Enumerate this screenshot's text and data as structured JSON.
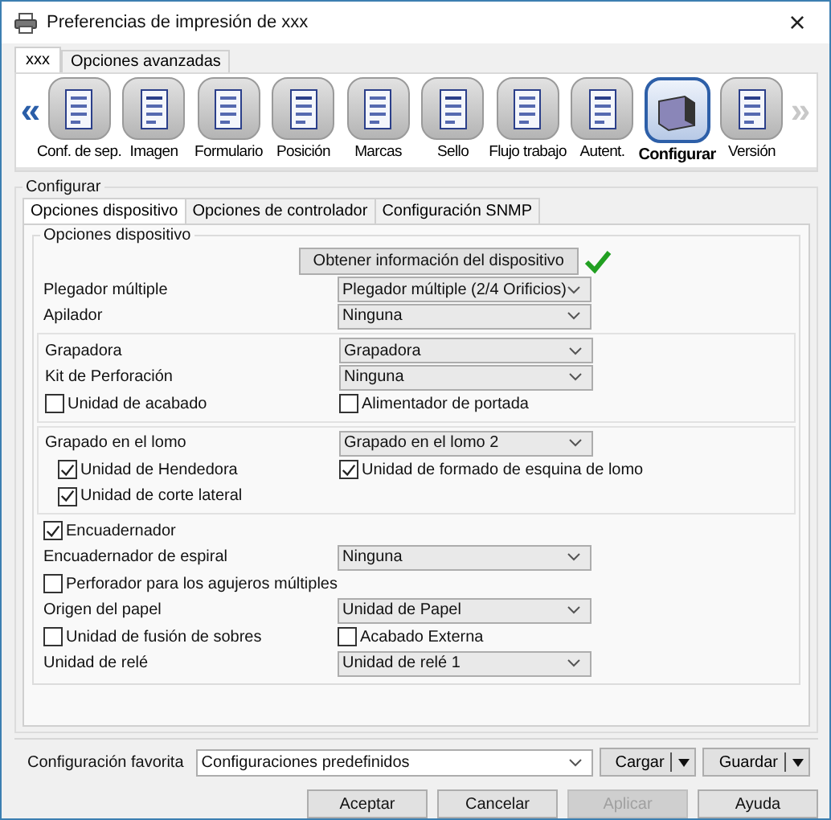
{
  "window": {
    "title": "Preferencias de impresión de xxx",
    "close": "×"
  },
  "tabs": [
    {
      "label": "xxx",
      "selected": true
    },
    {
      "label": "Opciones avanzadas",
      "selected": false
    }
  ],
  "toolbar": {
    "prev": "«",
    "next": "»",
    "next_disabled": true,
    "items": [
      {
        "label": "Conf. de sep.",
        "selected": false
      },
      {
        "label": "Imagen",
        "selected": false
      },
      {
        "label": "Formulario",
        "selected": false
      },
      {
        "label": "Posición",
        "selected": false
      },
      {
        "label": "Marcas",
        "selected": false
      },
      {
        "label": "Sello",
        "selected": false
      },
      {
        "label": "Flujo trabajo",
        "selected": false
      },
      {
        "label": "Autent.",
        "selected": false
      },
      {
        "label": "Configurar",
        "selected": true
      },
      {
        "label": "Versión",
        "selected": false
      }
    ]
  },
  "section": {
    "title": "Configurar",
    "subtabs": [
      {
        "label": "Opciones dispositivo",
        "selected": true
      },
      {
        "label": "Opciones de controlador",
        "selected": false
      },
      {
        "label": "Configuración SNMP",
        "selected": false
      }
    ],
    "group": {
      "title": "Opciones dispositivo",
      "fetch_button": "Obtener información del dispositivo",
      "fetched": true,
      "blocks": [
        {
          "kind": "plain",
          "rows": [
            {
              "kind": "select",
              "label": "Plegador múltiple",
              "value": "Plegador múltiple (2/4 Orificios)"
            },
            {
              "kind": "select",
              "label": "Apilador",
              "value": "Ninguna"
            }
          ]
        },
        {
          "kind": "box",
          "rows": [
            {
              "kind": "select",
              "label": "Grapadora",
              "value": "Grapadora"
            },
            {
              "kind": "select",
              "label": "Kit de Perforación",
              "value": "Ninguna"
            },
            {
              "kind": "checks",
              "indented": false,
              "items": [
                {
                  "label": "Unidad de acabado",
                  "checked": false
                },
                {
                  "label": "Alimentador de portada",
                  "checked": false
                }
              ]
            }
          ]
        },
        {
          "kind": "box",
          "rows": [
            {
              "kind": "select",
              "label": "Grapado en el lomo",
              "value": "Grapado en el lomo 2"
            },
            {
              "kind": "checks",
              "indented": true,
              "items": [
                {
                  "label": "Unidad de Hendedora",
                  "checked": true
                },
                {
                  "label": "Unidad de formado de esquina de lomo",
                  "checked": true
                }
              ]
            },
            {
              "kind": "checks",
              "indented": true,
              "items": [
                {
                  "label": "Unidad de corte lateral",
                  "checked": true
                }
              ]
            }
          ]
        },
        {
          "kind": "plain",
          "rows": [
            {
              "kind": "checks",
              "indented": false,
              "items": [
                {
                  "label": "Encuadernador",
                  "checked": true
                }
              ]
            },
            {
              "kind": "select",
              "label": "Encuadernador de espiral",
              "value": "Ninguna"
            },
            {
              "kind": "checks",
              "indented": false,
              "items": [
                {
                  "label": "Perforador para los agujeros múltiples",
                  "checked": false
                }
              ]
            },
            {
              "kind": "select",
              "label": "Origen del papel",
              "value": "Unidad de Papel"
            },
            {
              "kind": "checks",
              "indented": false,
              "items": [
                {
                  "label": "Unidad de fusión de sobres",
                  "checked": false
                },
                {
                  "label": "Acabado Externa",
                  "checked": false
                }
              ]
            },
            {
              "kind": "select",
              "label": "Unidad de relé",
              "value": "Unidad de relé 1"
            }
          ]
        }
      ]
    }
  },
  "favorites": {
    "label": "Configuración favorita",
    "value": "Configuraciones predefinidos",
    "load": "Cargar",
    "save": "Guardar"
  },
  "buttons": [
    {
      "label": "Aceptar",
      "disabled": false
    },
    {
      "label": "Cancelar",
      "disabled": false
    },
    {
      "label": "Aplicar",
      "disabled": true
    },
    {
      "label": "Ayuda",
      "disabled": false
    }
  ]
}
